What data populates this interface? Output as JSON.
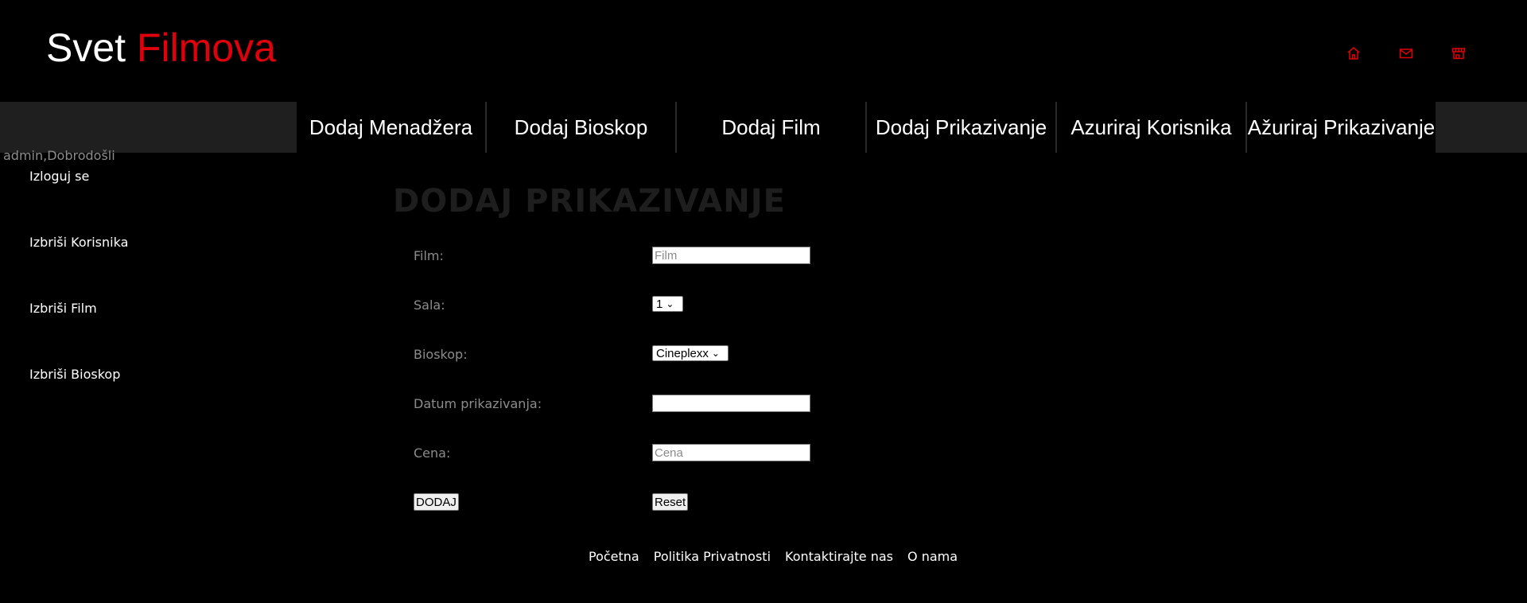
{
  "header": {
    "logo_part1": "Svet",
    "logo_part2": "Filmova",
    "icons": [
      "home-icon",
      "mail-icon",
      "store-icon"
    ],
    "accent_color": "#e0000b"
  },
  "nav": {
    "items": [
      {
        "label": "Dodaj Menadžera"
      },
      {
        "label": "Dodaj Bioskop"
      },
      {
        "label": "Dodaj Film"
      },
      {
        "label": "Dodaj Prikazivanje"
      },
      {
        "label": "Azuriraj Korisnika"
      },
      {
        "label": "Ažuriraj Prikazivanje"
      }
    ]
  },
  "welcome": "admin,Dobrodošli",
  "sidebar": {
    "items": [
      {
        "label": "Izloguj se"
      },
      {
        "label": "Izbriši Korisnika"
      },
      {
        "label": "Izbriši Film"
      },
      {
        "label": "Izbriši Bioskop"
      }
    ]
  },
  "form": {
    "title": "DODAJ PRIKAZIVANJE",
    "film_label": "Film:",
    "film_placeholder": "Film",
    "sala_label": "Sala:",
    "sala_value": "1",
    "bioskop_label": "Bioskop:",
    "bioskop_value": "Cineplexx",
    "datum_label": "Datum prikazivanja:",
    "cena_label": "Cena:",
    "cena_placeholder": "Cena",
    "submit_label": "DODAJ",
    "reset_label": "Reset"
  },
  "footer": {
    "links": [
      {
        "label": "Početna"
      },
      {
        "label": "Politika Privatnosti"
      },
      {
        "label": "Kontaktirajte nas"
      },
      {
        "label": "O nama"
      }
    ]
  }
}
